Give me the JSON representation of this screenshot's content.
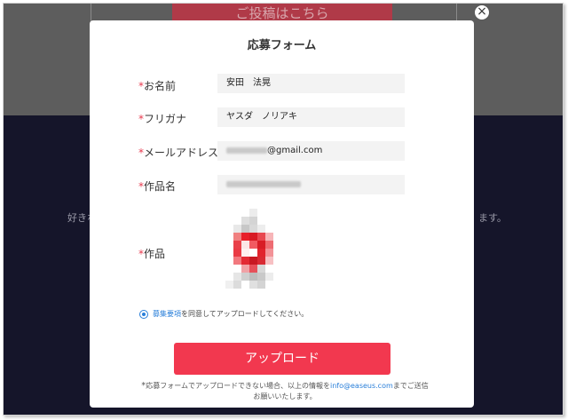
{
  "background": {
    "button_label": "ご投稿はこちら",
    "left_text": "好きな",
    "right_text": "ます。"
  },
  "modal": {
    "title": "応募フォーム",
    "close_label": "×",
    "required_mark": "*",
    "fields": [
      {
        "label": "お名前",
        "value": "安田　法晃"
      },
      {
        "label": "フリガナ",
        "value": "ヤスダ　ノリアキ"
      },
      {
        "label": "メールアドレス",
        "value": "@gmail.com"
      },
      {
        "label": "作品名",
        "value": ""
      },
      {
        "label": "作品",
        "value": ""
      }
    ],
    "agreement": {
      "link_text": "募集要項",
      "text": "を同意してアップロードしてください。"
    },
    "upload_button": "アップロード",
    "note": {
      "star": "*",
      "text_before": "応募フォームでアップロードできない場合、以上の情報を",
      "email": "info@easeus.com",
      "text_after": "までご送信お願いいたします。"
    }
  },
  "colors": {
    "accent": "#f2384f",
    "link": "#2a7fd9",
    "overlay_top": "#5d5d5d",
    "overlay_bottom": "#15152a"
  }
}
